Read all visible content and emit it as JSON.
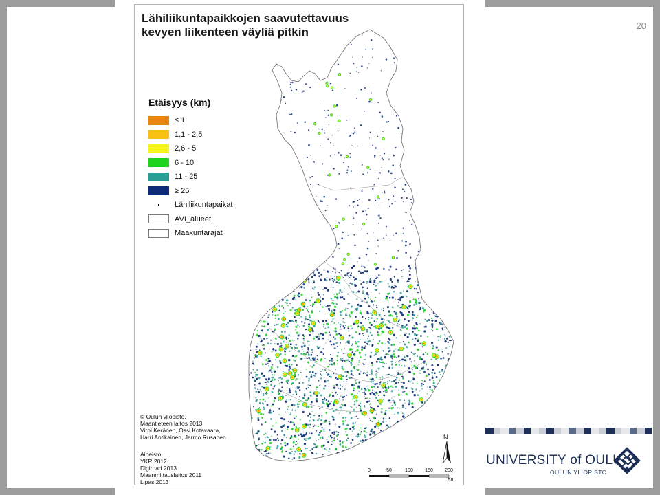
{
  "slide": {
    "number": "20"
  },
  "map": {
    "title_line1": "Lähiliikuntapaikkojen saavutettavuus",
    "title_line2": "kevyen liikenteen väyliä pitkin",
    "legend": {
      "title": "Etäisyys (km)",
      "items": [
        {
          "label": "≤ 1",
          "color": "#e8850c",
          "kind": "fill"
        },
        {
          "label": "1,1 - 2,5",
          "color": "#f7c012",
          "kind": "fill"
        },
        {
          "label": "2,6 - 5",
          "color": "#f5f51a",
          "kind": "fill"
        },
        {
          "label": "6 - 10",
          "color": "#1fd31f",
          "kind": "fill"
        },
        {
          "label": "11 - 25",
          "color": "#2a9d95",
          "kind": "fill"
        },
        {
          "label": "≥ 25",
          "color": "#0d2a78",
          "kind": "fill"
        },
        {
          "label": "Lähiliikuntapaikat",
          "color": "#000000",
          "kind": "dot"
        },
        {
          "label": "AVI_alueet",
          "color": "#ffffff",
          "kind": "outline"
        },
        {
          "label": "Maakuntarajat",
          "color": "#ffffff",
          "kind": "outline"
        }
      ]
    },
    "credits": [
      "© Oulun yliopisto,",
      "Maantieteen laitos 2013",
      "Virpi Keränen, Ossi Kotavaara,",
      "Harri Antikainen, Jarmo Rusanen"
    ],
    "sources": [
      "Aineisto:",
      "YKR 2012",
      "Digiroad 2013",
      "Maanmittauslaitos 2011",
      "Lipas 2013"
    ],
    "north_label": "N",
    "scale": {
      "ticks": [
        "0",
        "50",
        "100",
        "150",
        "200"
      ],
      "unit": "Km"
    }
  },
  "branding": {
    "name": "UNIVERSITY of OULU",
    "subtitle": "OULUN YLIOPISTO",
    "color": "#1d2f57"
  }
}
